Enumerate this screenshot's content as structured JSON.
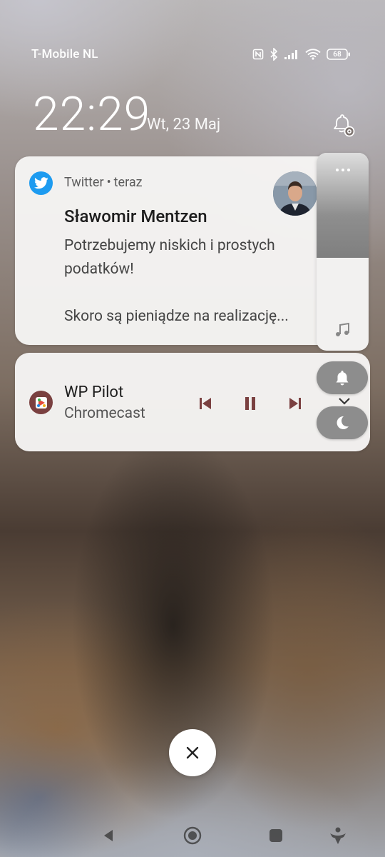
{
  "status_bar": {
    "carrier": "T-Mobile NL",
    "battery": "68",
    "icons": [
      "nfc-icon",
      "bluetooth-icon",
      "signal-icon",
      "wifi-icon",
      "battery-icon"
    ]
  },
  "lockscreen": {
    "time": "22:29",
    "date": "Wt, 23 Maj"
  },
  "notification": {
    "app": "Twitter",
    "separator": "•",
    "when": "teraz",
    "sender": "Sławomir Mentzen",
    "line1": "Potrzebujemy niskich i prostych podatków!",
    "line2": "Skoro są pieniądze na realizację...",
    "accent": "#1d9bf0"
  },
  "media": {
    "title": "WP Pilot",
    "subtitle": "Chromecast",
    "accent": "#7a4040"
  },
  "volume": {
    "level": 0.47
  }
}
